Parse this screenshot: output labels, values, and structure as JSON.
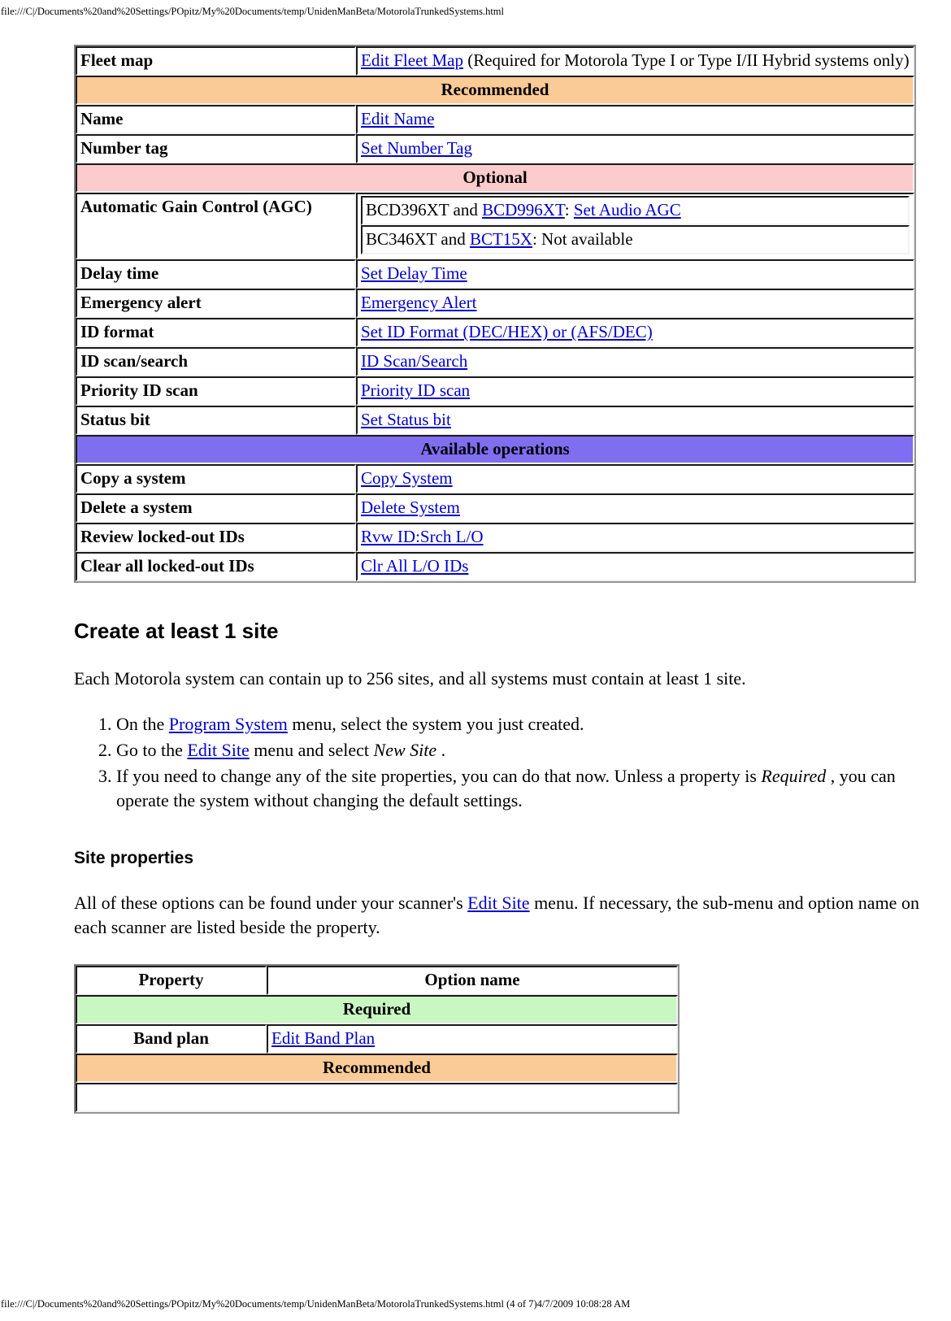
{
  "page": {
    "header_url": "file:///C|/Documents%20and%20Settings/POpitz/My%20Documents/temp/UnidenManBeta/MotorolaTrunkedSystems.html",
    "footer_url": "file:///C|/Documents%20and%20Settings/POpitz/My%20Documents/temp/UnidenManBeta/MotorolaTrunkedSystems.html (4 of 7)4/7/2009 10:08:28 AM"
  },
  "colors": {
    "link": "#0000cc",
    "band_recommended": "#fbcb97",
    "band_optional": "#fccbcb",
    "band_available": "#7f6ef0",
    "band_required": "#c9f7c2"
  },
  "system_table": {
    "fleet_map": {
      "property": "Fleet map",
      "value_link": "Edit Fleet Map",
      "value_rest": " (Required for Motorola Type I or Type I/II Hybrid systems only)"
    },
    "band_recommended": "Recommended",
    "name": {
      "property": "Name",
      "value_link": "Edit Name"
    },
    "number_tag": {
      "property": "Number tag",
      "value_link": "Set Number Tag"
    },
    "band_optional": "Optional",
    "agc": {
      "property": "Automatic Gain Control (AGC)",
      "row1_pre": "BCD396XT and ",
      "row1_link": "BCD996XT",
      "row1_mid": ": ",
      "row1_link2": "Set Audio AGC",
      "row2_pre": "BC346XT and ",
      "row2_link": "BCT15X",
      "row2_post": ": Not available"
    },
    "delay_time": {
      "property": "Delay time",
      "value_link": "Set Delay Time"
    },
    "emergency_alert": {
      "property": "Emergency alert",
      "value_link": "Emergency Alert"
    },
    "id_format": {
      "property": "ID format",
      "value_link": "Set ID Format (DEC/HEX) or (AFS/DEC)"
    },
    "id_scan_search": {
      "property": "ID scan/search",
      "value_link": "ID Scan/Search"
    },
    "priority_id_scan": {
      "property": "Priority ID scan",
      "value_link": "Priority ID scan"
    },
    "status_bit": {
      "property": "Status bit",
      "value_link": "Set Status bit"
    },
    "band_available": "Available operations",
    "copy_system": {
      "property": "Copy a system",
      "value_link": "Copy System"
    },
    "delete_system": {
      "property": "Delete a system",
      "value_link": "Delete System"
    },
    "review_locked": {
      "property": "Review locked-out IDs",
      "value_link": "Rvw ID:Srch L/O"
    },
    "clear_locked": {
      "property": "Clear all locked-out IDs",
      "value_link": "Clr All L/O IDs"
    }
  },
  "create_site": {
    "heading": "Create at least 1 site",
    "intro": "Each Motorola system can contain up to 256 sites, and all systems must contain at least 1 site.",
    "step1_pre": "On the ",
    "step1_link": "Program System",
    "step1_post": " menu, select the system you just created.",
    "step2_pre": "Go to the ",
    "step2_link": "Edit Site",
    "step2_mid": " menu and select ",
    "step2_italic": "New Site",
    "step2_post": " .",
    "step3_pre": "If you need to change any of the site properties, you can do that now. Unless a property is ",
    "step3_italic": "Required",
    "step3_post": " , you can operate the system without changing the default settings."
  },
  "site_properties": {
    "heading": "Site properties",
    "intro_pre": "All of these options can be found under your scanner's ",
    "intro_link": "Edit Site",
    "intro_post": " menu. If necessary, the sub-menu and option name on each scanner are listed beside the property."
  },
  "site_table": {
    "header_property": "Property",
    "header_option": "Option name",
    "band_required": "Required",
    "band_plan": {
      "property": "Band plan",
      "value_link": "Edit Band Plan"
    },
    "band_recommended": "Recommended"
  }
}
